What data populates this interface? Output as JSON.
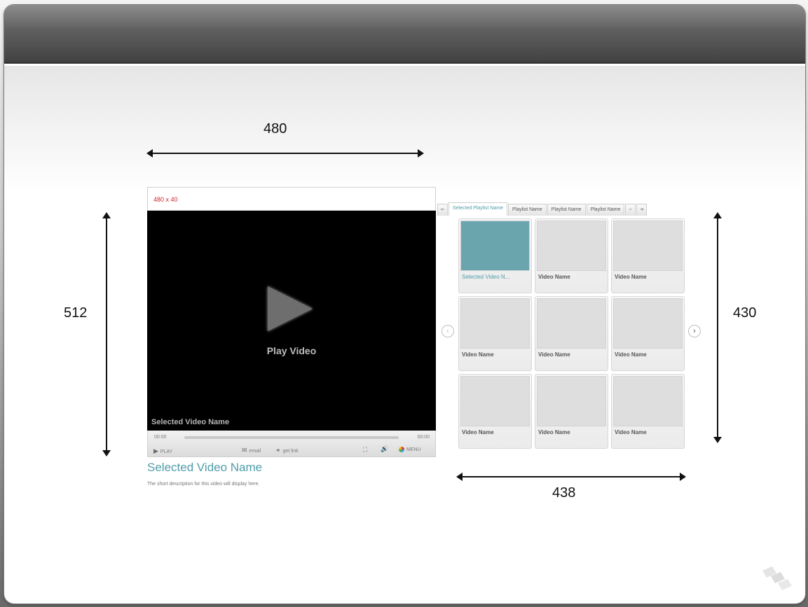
{
  "dimensions": {
    "player_width": "480",
    "player_height": "512",
    "playlist_height": "430",
    "playlist_width": "438"
  },
  "player": {
    "ad_banner": "480 x 40",
    "play_caption": "Play Video",
    "overlay_video_name": "Selected Video Name",
    "time_current": "00:00",
    "time_total": "00:00",
    "controls": {
      "play_label": "PLAY",
      "email_label": "email",
      "getlink_label": "get link",
      "menu_label": "MENU"
    },
    "video_title": "Selected Video Name",
    "video_description": "The short description for this video will display here."
  },
  "playlist": {
    "tabs": [
      {
        "label": "Selected Playlist Name",
        "active": true
      },
      {
        "label": "Playlist Name",
        "active": false
      },
      {
        "label": "Playlist Name",
        "active": false
      },
      {
        "label": "Playlist Name",
        "active": false
      }
    ],
    "thumbnails": [
      {
        "label": "Selected Video N...",
        "selected": true
      },
      {
        "label": "Video Name",
        "selected": false
      },
      {
        "label": "Video Name",
        "selected": false
      },
      {
        "label": "Video Name",
        "selected": false
      },
      {
        "label": "Video Name",
        "selected": false
      },
      {
        "label": "Video Name",
        "selected": false
      },
      {
        "label": "Video Name",
        "selected": false
      },
      {
        "label": "Video Name",
        "selected": false
      },
      {
        "label": "Video Name",
        "selected": false
      }
    ]
  },
  "colors": {
    "accent": "#4f9ea9",
    "selected_thumb": "#6aa5ae",
    "ad_text": "#d0262b",
    "header_dark": "#424242"
  }
}
